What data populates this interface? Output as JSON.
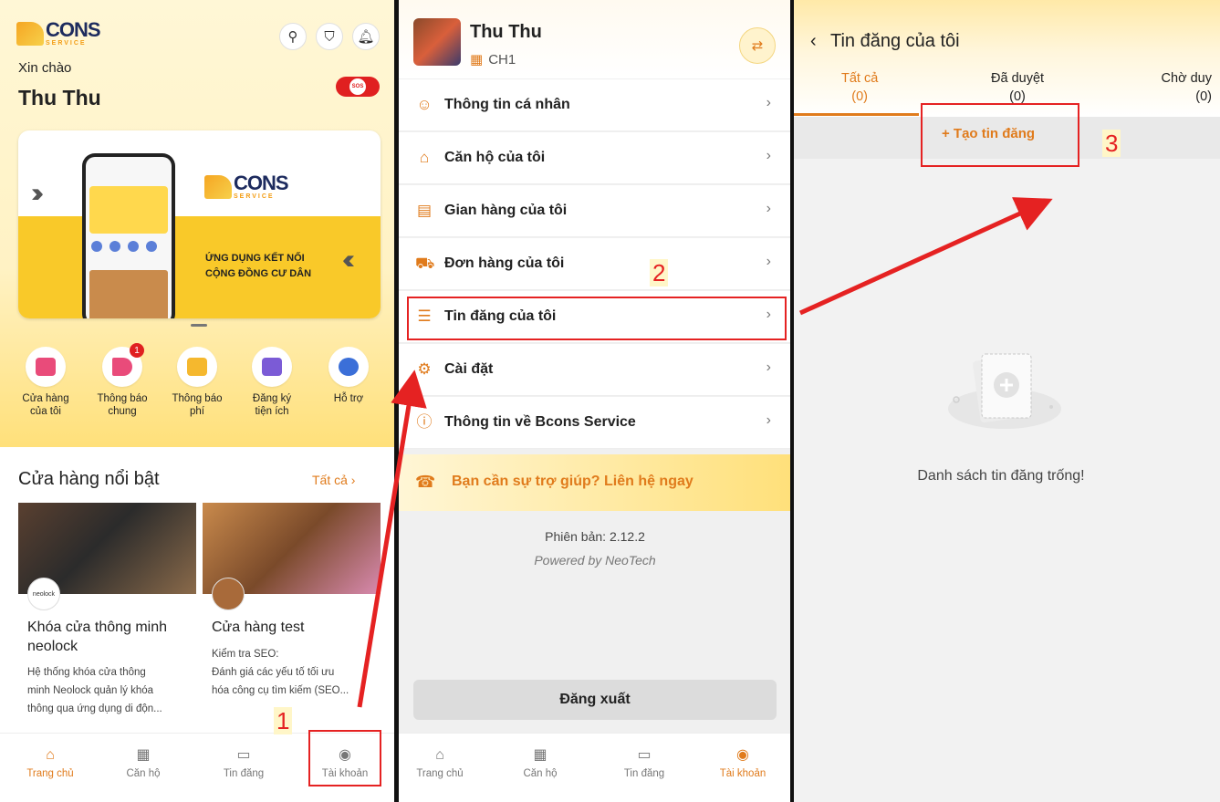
{
  "panel1": {
    "logo": {
      "main": "CONS",
      "sub": "SERVICE"
    },
    "greeting": "Xin chào",
    "user_name": "Thu Thu",
    "sos_label": "SOS",
    "banner": {
      "logo_main": "CONS",
      "logo_sub": "SERVICE",
      "slogan_line1": "ỨNG DỤNG KẾT NỐI",
      "slogan_line2": "CỘNG ĐỒNG CƯ DÂN"
    },
    "quick_actions": [
      {
        "label1": "Cửa hàng",
        "label2": "của tôi",
        "color": "#e94b7a",
        "badge": ""
      },
      {
        "label1": "Thông báo",
        "label2": "chung",
        "color": "#e94b7a",
        "badge": "1"
      },
      {
        "label1": "Thông báo",
        "label2": "phí",
        "color": "#f5b82e",
        "badge": ""
      },
      {
        "label1": "Đăng ký",
        "label2": "tiện ích",
        "color": "#7b5bd6",
        "badge": ""
      },
      {
        "label1": "Hỗ trợ",
        "label2": "",
        "color": "#3b6fd8",
        "badge": ""
      }
    ],
    "featured_title": "Cửa hàng nổi bật",
    "see_all": "Tất cả ›",
    "cards": [
      {
        "avatar_text": "neolock",
        "title": "Khóa cửa thông minh neolock",
        "desc_lines": [
          "Hệ thống khóa cửa thông",
          "minh Neolock quản lý khóa",
          "thông qua ứng dụng di độn..."
        ]
      },
      {
        "avatar_text": "",
        "title": "Cửa hàng test",
        "desc_lines": [
          "Kiểm tra SEO:",
          "Đánh giá các yếu tố tối ưu",
          "hóa công cụ tìm kiếm (SEO..."
        ]
      }
    ],
    "nav": [
      "Trang chủ",
      "Căn hộ",
      "Tin đăng",
      "Tài khoản"
    ]
  },
  "panel2": {
    "user_name": "Thu Thu",
    "unit": "CH1",
    "menu": [
      {
        "icon": "user-icon",
        "label": "Thông tin cá nhân"
      },
      {
        "icon": "home-icon",
        "label": "Căn hộ của tôi"
      },
      {
        "icon": "store-icon",
        "label": "Gian hàng của tôi"
      },
      {
        "icon": "cart-icon",
        "label": "Đơn hàng của tôi"
      },
      {
        "icon": "news-icon",
        "label": "Tin đăng của tôi"
      },
      {
        "icon": "gear-icon",
        "label": "Cài đặt"
      },
      {
        "icon": "info-icon",
        "label": "Thông tin về Bcons Service"
      }
    ],
    "help_text": "Bạn cần sự trợ giúp? Liên hệ ngay",
    "version": "Phiên bản: 2.12.2",
    "powered_by": "Powered by NeoTech",
    "logout": "Đăng xuất",
    "nav": [
      "Trang chủ",
      "Căn hộ",
      "Tin đăng",
      "Tài khoản"
    ]
  },
  "panel3": {
    "title": "Tin đăng của tôi",
    "tabs": [
      {
        "label": "Tất cả",
        "count": "(0)"
      },
      {
        "label": "Đã duyệt",
        "count": "(0)"
      },
      {
        "label": "Chờ duy",
        "count": "(0)"
      }
    ],
    "create_button": "+ Tạo tin đăng",
    "empty_text": "Danh sách tin đăng trống!"
  },
  "annotations": [
    "1",
    "2",
    "3"
  ],
  "colors": {
    "accent": "#e07b1c",
    "annotation": "#e52222",
    "brand_yellow": "#f9c929"
  }
}
